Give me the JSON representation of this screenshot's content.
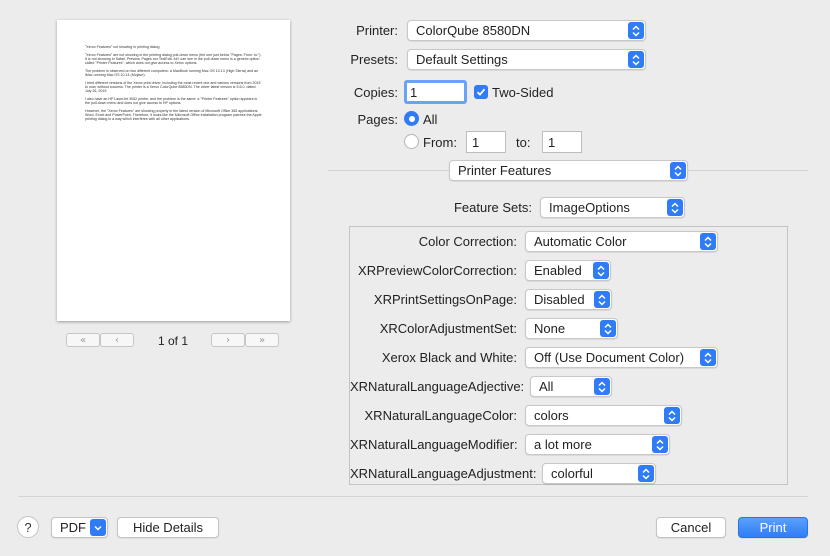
{
  "preview": {
    "paragraphs": [
      "\"Xerox Features\" not showing in printing dialog",
      "\"Xerox Features\" are not showing in the printing dialog pull-down menu (the one just below \"Pages: From: to:\"). It is not showing in Safari, Preview, Pages nor TextEdit. All I can see in the pull-down menu is a generic option called \"Printer Features\", which does not give access to Xerox options.",
      "The problem is observed on two different computers: a MacBook running Mac OS 10.13 (High Sierra) and an iMac running Mac OS 10.14 (Mojave).",
      "I tried different versions of the Xerox print driver, including the most recent one and various versions from 2015 to now, without success. The printer is a Xerox ColorQube 8580DN. The driver latest version is 5.6.0, dated July 26, 2019.",
      "I also have an HP LaserJet 3052 printer, and the problem is the same: a \"Printer Features\" option appears in the pull-down menu and does not give access to HP options.",
      "However, the \"Xerox Features\" are showing properly in the latest version of Microsoft Office 365 applications: Word, Excel and PowerPoint. Therefore, it looks like the Microsoft Office installation program patches the Apple printing dialog in a way which interferes with all other applications."
    ],
    "page_indicator": "1 of 1"
  },
  "printer": {
    "label": "Printer:",
    "value": "ColorQube 8580DN"
  },
  "presets": {
    "label": "Presets:",
    "value": "Default Settings"
  },
  "copies": {
    "label": "Copies:",
    "value": "1",
    "two_sided_label": "Two-Sided"
  },
  "pages": {
    "label": "Pages:",
    "all_label": "All",
    "from_label": "From:",
    "from_value": "1",
    "to_label": "to:",
    "to_value": "1"
  },
  "section_popup": "Printer Features",
  "feature_sets": {
    "label": "Feature Sets:",
    "value": "ImageOptions"
  },
  "features": [
    {
      "label": "Color Correction:",
      "value": "Automatic Color"
    },
    {
      "label": "XRPreviewColorCorrection:",
      "value": "Enabled"
    },
    {
      "label": "XRPrintSettingsOnPage:",
      "value": "Disabled"
    },
    {
      "label": "XRColorAdjustmentSet:",
      "value": "None"
    },
    {
      "label": "Xerox Black and White:",
      "value": "Off (Use Document Color)"
    },
    {
      "label": "XRNaturalLanguageAdjective:",
      "value": "All"
    },
    {
      "label": "XRNaturalLanguageColor:",
      "value": "colors"
    },
    {
      "label": "XRNaturalLanguageModifier:",
      "value": "a lot more"
    },
    {
      "label": "XRNaturalLanguageAdjustment:",
      "value": "colorful"
    }
  ],
  "bottom": {
    "help": "?",
    "pdf": "PDF",
    "hide_details": "Hide Details",
    "cancel": "Cancel",
    "print": "Print"
  },
  "colors": {
    "accent": "#2f7cf6",
    "background": "#ececec"
  }
}
